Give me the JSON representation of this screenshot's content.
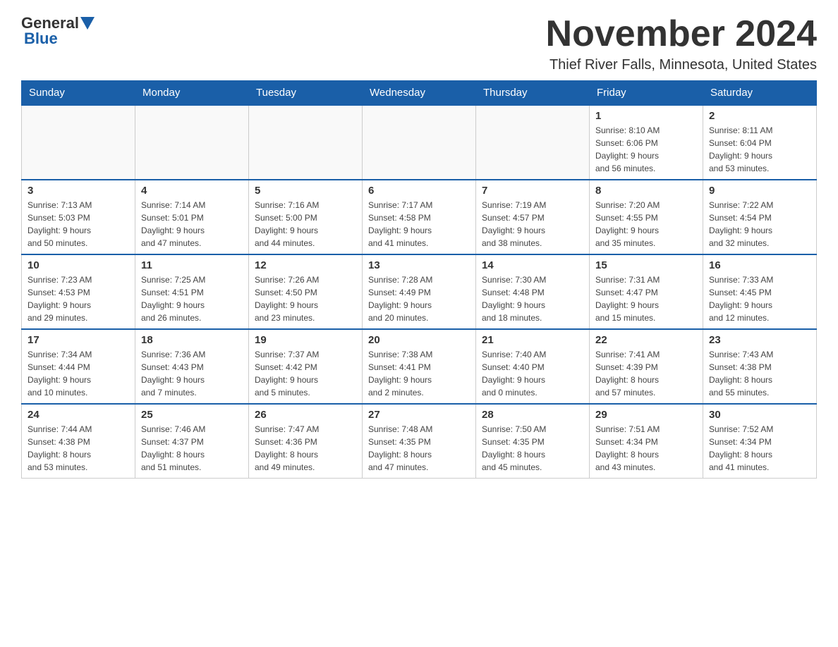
{
  "header": {
    "logo_general": "General",
    "logo_blue": "Blue",
    "month_title": "November 2024",
    "location": "Thief River Falls, Minnesota, United States"
  },
  "days_of_week": [
    "Sunday",
    "Monday",
    "Tuesday",
    "Wednesday",
    "Thursday",
    "Friday",
    "Saturday"
  ],
  "weeks": [
    [
      {
        "day": "",
        "info": ""
      },
      {
        "day": "",
        "info": ""
      },
      {
        "day": "",
        "info": ""
      },
      {
        "day": "",
        "info": ""
      },
      {
        "day": "",
        "info": ""
      },
      {
        "day": "1",
        "info": "Sunrise: 8:10 AM\nSunset: 6:06 PM\nDaylight: 9 hours\nand 56 minutes."
      },
      {
        "day": "2",
        "info": "Sunrise: 8:11 AM\nSunset: 6:04 PM\nDaylight: 9 hours\nand 53 minutes."
      }
    ],
    [
      {
        "day": "3",
        "info": "Sunrise: 7:13 AM\nSunset: 5:03 PM\nDaylight: 9 hours\nand 50 minutes."
      },
      {
        "day": "4",
        "info": "Sunrise: 7:14 AM\nSunset: 5:01 PM\nDaylight: 9 hours\nand 47 minutes."
      },
      {
        "day": "5",
        "info": "Sunrise: 7:16 AM\nSunset: 5:00 PM\nDaylight: 9 hours\nand 44 minutes."
      },
      {
        "day": "6",
        "info": "Sunrise: 7:17 AM\nSunset: 4:58 PM\nDaylight: 9 hours\nand 41 minutes."
      },
      {
        "day": "7",
        "info": "Sunrise: 7:19 AM\nSunset: 4:57 PM\nDaylight: 9 hours\nand 38 minutes."
      },
      {
        "day": "8",
        "info": "Sunrise: 7:20 AM\nSunset: 4:55 PM\nDaylight: 9 hours\nand 35 minutes."
      },
      {
        "day": "9",
        "info": "Sunrise: 7:22 AM\nSunset: 4:54 PM\nDaylight: 9 hours\nand 32 minutes."
      }
    ],
    [
      {
        "day": "10",
        "info": "Sunrise: 7:23 AM\nSunset: 4:53 PM\nDaylight: 9 hours\nand 29 minutes."
      },
      {
        "day": "11",
        "info": "Sunrise: 7:25 AM\nSunset: 4:51 PM\nDaylight: 9 hours\nand 26 minutes."
      },
      {
        "day": "12",
        "info": "Sunrise: 7:26 AM\nSunset: 4:50 PM\nDaylight: 9 hours\nand 23 minutes."
      },
      {
        "day": "13",
        "info": "Sunrise: 7:28 AM\nSunset: 4:49 PM\nDaylight: 9 hours\nand 20 minutes."
      },
      {
        "day": "14",
        "info": "Sunrise: 7:30 AM\nSunset: 4:48 PM\nDaylight: 9 hours\nand 18 minutes."
      },
      {
        "day": "15",
        "info": "Sunrise: 7:31 AM\nSunset: 4:47 PM\nDaylight: 9 hours\nand 15 minutes."
      },
      {
        "day": "16",
        "info": "Sunrise: 7:33 AM\nSunset: 4:45 PM\nDaylight: 9 hours\nand 12 minutes."
      }
    ],
    [
      {
        "day": "17",
        "info": "Sunrise: 7:34 AM\nSunset: 4:44 PM\nDaylight: 9 hours\nand 10 minutes."
      },
      {
        "day": "18",
        "info": "Sunrise: 7:36 AM\nSunset: 4:43 PM\nDaylight: 9 hours\nand 7 minutes."
      },
      {
        "day": "19",
        "info": "Sunrise: 7:37 AM\nSunset: 4:42 PM\nDaylight: 9 hours\nand 5 minutes."
      },
      {
        "day": "20",
        "info": "Sunrise: 7:38 AM\nSunset: 4:41 PM\nDaylight: 9 hours\nand 2 minutes."
      },
      {
        "day": "21",
        "info": "Sunrise: 7:40 AM\nSunset: 4:40 PM\nDaylight: 9 hours\nand 0 minutes."
      },
      {
        "day": "22",
        "info": "Sunrise: 7:41 AM\nSunset: 4:39 PM\nDaylight: 8 hours\nand 57 minutes."
      },
      {
        "day": "23",
        "info": "Sunrise: 7:43 AM\nSunset: 4:38 PM\nDaylight: 8 hours\nand 55 minutes."
      }
    ],
    [
      {
        "day": "24",
        "info": "Sunrise: 7:44 AM\nSunset: 4:38 PM\nDaylight: 8 hours\nand 53 minutes."
      },
      {
        "day": "25",
        "info": "Sunrise: 7:46 AM\nSunset: 4:37 PM\nDaylight: 8 hours\nand 51 minutes."
      },
      {
        "day": "26",
        "info": "Sunrise: 7:47 AM\nSunset: 4:36 PM\nDaylight: 8 hours\nand 49 minutes."
      },
      {
        "day": "27",
        "info": "Sunrise: 7:48 AM\nSunset: 4:35 PM\nDaylight: 8 hours\nand 47 minutes."
      },
      {
        "day": "28",
        "info": "Sunrise: 7:50 AM\nSunset: 4:35 PM\nDaylight: 8 hours\nand 45 minutes."
      },
      {
        "day": "29",
        "info": "Sunrise: 7:51 AM\nSunset: 4:34 PM\nDaylight: 8 hours\nand 43 minutes."
      },
      {
        "day": "30",
        "info": "Sunrise: 7:52 AM\nSunset: 4:34 PM\nDaylight: 8 hours\nand 41 minutes."
      }
    ]
  ]
}
